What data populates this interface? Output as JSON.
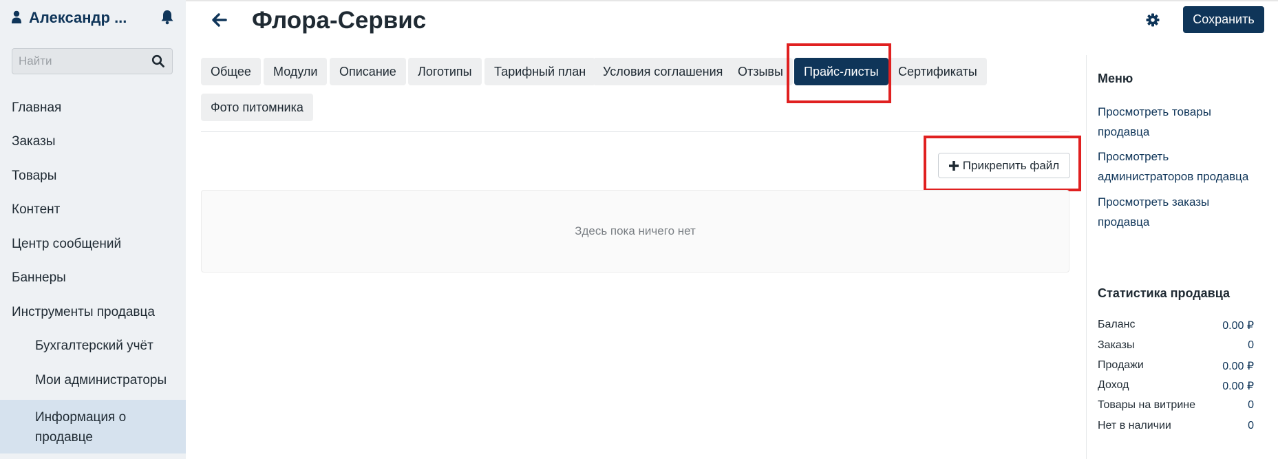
{
  "sidebar": {
    "user_name": "Александр ...",
    "search_placeholder": "Найти",
    "items": [
      {
        "label": "Главная"
      },
      {
        "label": "Заказы"
      },
      {
        "label": "Товары"
      },
      {
        "label": "Контент"
      },
      {
        "label": "Центр сообщений"
      },
      {
        "label": "Баннеры"
      },
      {
        "label": "Инструменты продавца"
      }
    ],
    "sub_items": [
      {
        "label": "Бухгалтерский учёт"
      },
      {
        "label": "Мои администраторы"
      },
      {
        "label": "Информация о продавце",
        "active": true
      }
    ]
  },
  "header": {
    "title": "Флора-Сервис",
    "save_label": "Сохранить"
  },
  "tabs": [
    {
      "label": "Общее"
    },
    {
      "label": "Модули"
    },
    {
      "label": "Описание"
    },
    {
      "label": "Логотипы"
    },
    {
      "label": "Тарифный план"
    },
    {
      "label": "Условия соглашения"
    },
    {
      "label": "Отзывы"
    },
    {
      "label": "Прайс-листы",
      "active": true
    },
    {
      "label": "Сертификаты"
    },
    {
      "label": "Фото питомника"
    }
  ],
  "content": {
    "attach_label": "Прикрепить файл",
    "empty_text": "Здесь пока ничего нет"
  },
  "right_panel": {
    "menu_heading": "Меню",
    "menu_links": [
      {
        "label": "Просмотреть товары продавца"
      },
      {
        "label": "Просмотреть администраторов продавца"
      },
      {
        "label": "Просмотреть заказы продавца"
      }
    ],
    "stats_heading": "Статистика продавца",
    "stats": [
      {
        "label": "Баланс",
        "value": "0.00 ₽"
      },
      {
        "label": "Заказы",
        "value": "0"
      },
      {
        "label": "Продажи",
        "value": "0.00 ₽"
      },
      {
        "label": "Доход",
        "value": "0.00 ₽"
      },
      {
        "label": "Товары на витрине",
        "value": "0"
      },
      {
        "label": "Нет в наличии",
        "value": "0"
      }
    ]
  },
  "colors": {
    "accent": "#0f3559",
    "highlight": "#e02020",
    "sidebar_bg": "#eef1f4"
  },
  "icons": [
    "user-icon",
    "bell-icon",
    "search-icon",
    "back-arrow-icon",
    "gear-icon",
    "plus-icon"
  ]
}
